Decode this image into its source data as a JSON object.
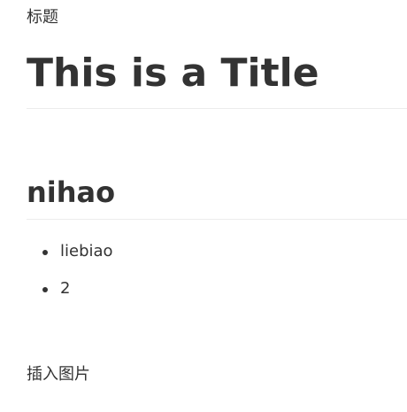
{
  "document": {
    "top_label": "标题",
    "title": "This is a Title",
    "section_heading": "nihao",
    "list_items": [
      "liebiao",
      "2"
    ],
    "bottom_label": "插入图片"
  }
}
